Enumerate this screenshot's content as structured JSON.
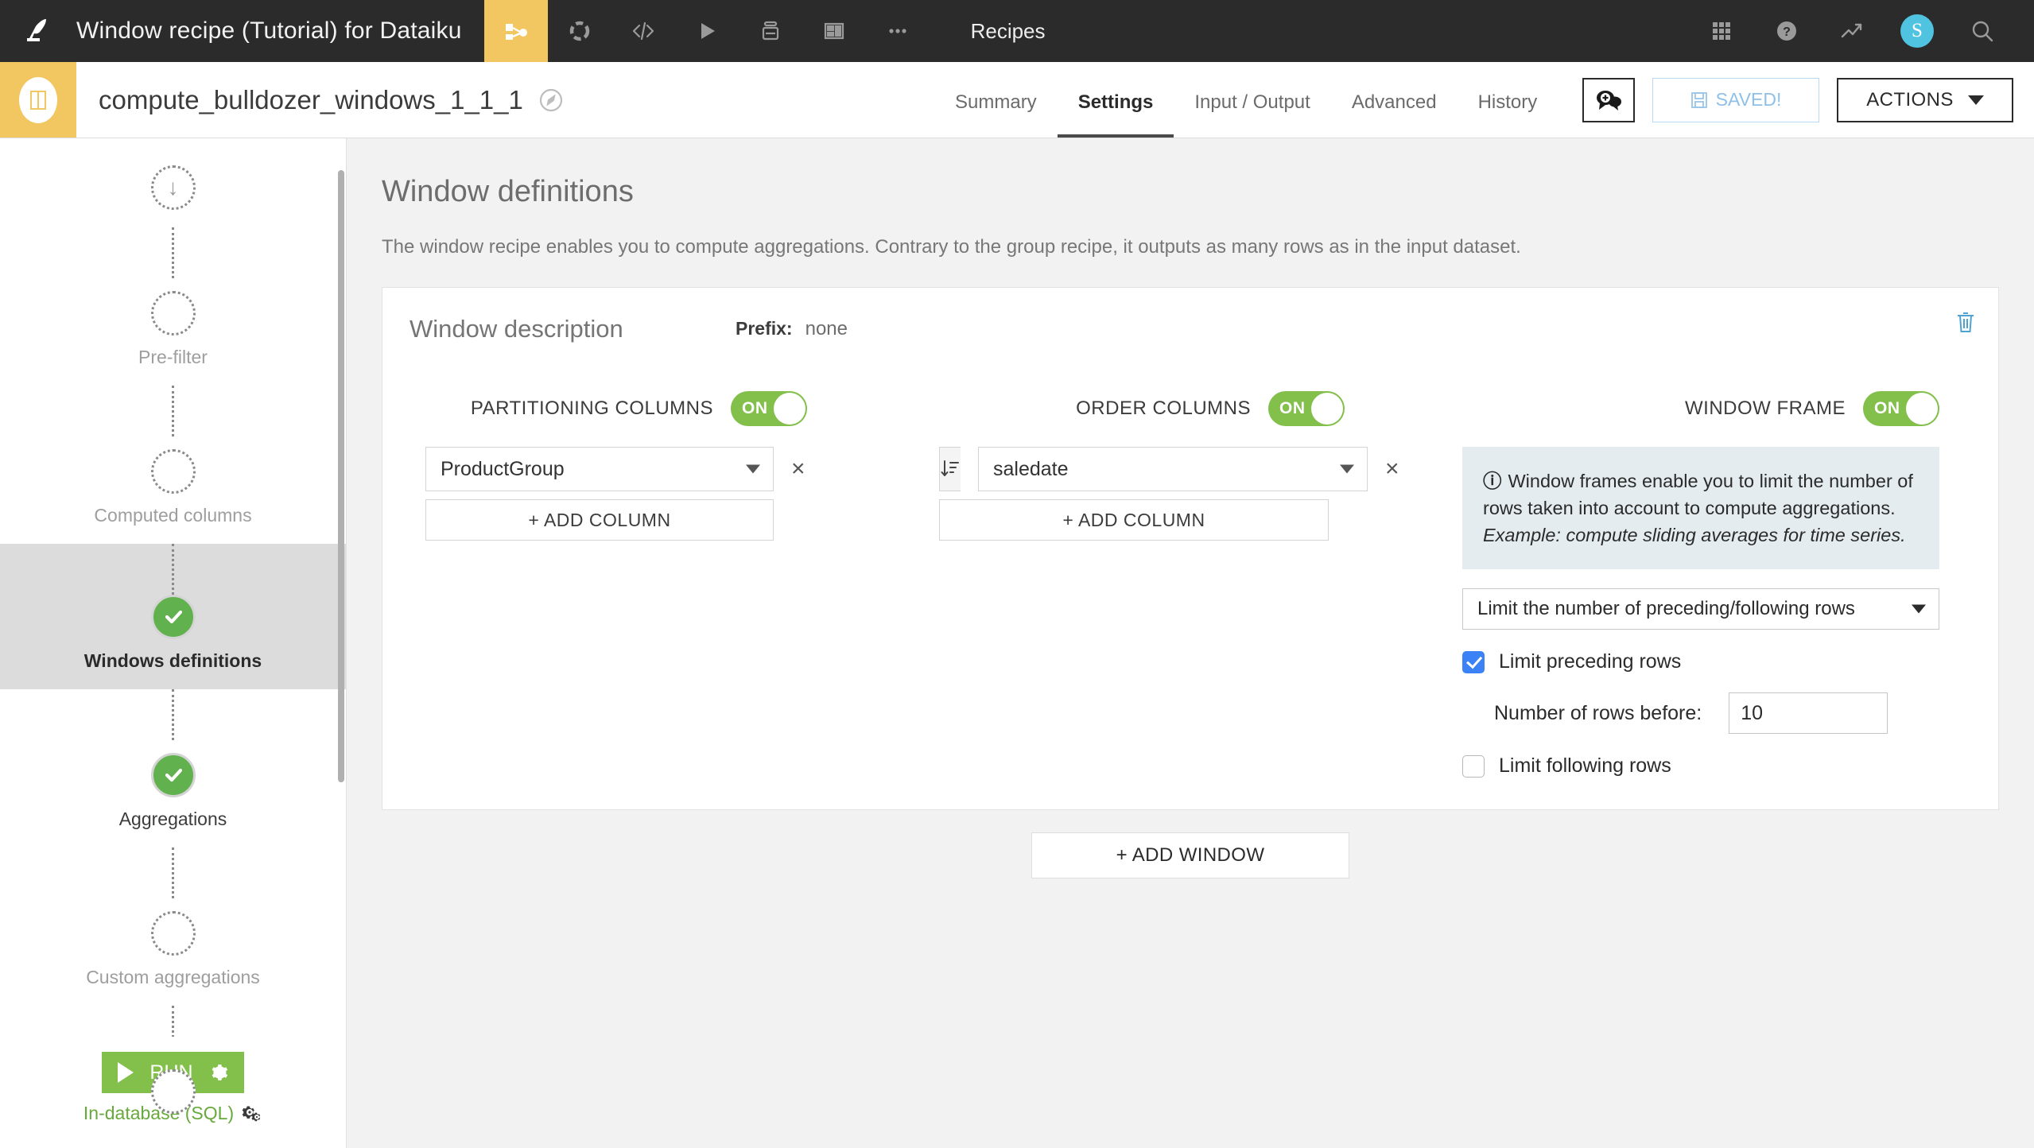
{
  "topbar": {
    "project_title": "Window recipe (Tutorial) for Dataiku",
    "section_label": "Recipes",
    "icons": [
      {
        "name": "flow-icon",
        "active": true
      },
      {
        "name": "dataset-icon",
        "active": false
      },
      {
        "name": "code-icon",
        "active": false
      },
      {
        "name": "jobs-play-icon",
        "active": false
      },
      {
        "name": "notebooks-icon",
        "active": false
      },
      {
        "name": "dashboards-icon",
        "active": false
      },
      {
        "name": "more-icon",
        "active": false
      }
    ],
    "right_icons": [
      {
        "name": "apps-grid-icon"
      },
      {
        "name": "help-icon"
      },
      {
        "name": "activity-icon"
      },
      {
        "name": "search-icon"
      }
    ],
    "avatar_initial": "S"
  },
  "subheader": {
    "recipe_name": "compute_bulldozer_windows_1_1_1",
    "tabs": [
      {
        "label": "Summary",
        "active": false
      },
      {
        "label": "Settings",
        "active": true
      },
      {
        "label": "Input / Output",
        "active": false
      },
      {
        "label": "Advanced",
        "active": false
      },
      {
        "label": "History",
        "active": false
      }
    ],
    "saved_label": "SAVED!",
    "actions_label": "ACTIONS"
  },
  "sidebar": {
    "steps": [
      {
        "label": "",
        "state": "start"
      },
      {
        "label": "Pre-filter",
        "state": "empty"
      },
      {
        "label": "Computed columns",
        "state": "empty"
      },
      {
        "label": "Windows definitions",
        "state": "done",
        "selected": true
      },
      {
        "label": "Aggregations",
        "state": "done"
      },
      {
        "label": "Custom aggregations",
        "state": "empty"
      },
      {
        "label": "",
        "state": "empty"
      }
    ],
    "run_label": "RUN",
    "engine_label": "In-database (SQL)"
  },
  "main": {
    "page_title": "Window definitions",
    "page_desc": "The window recipe enables you to compute aggregations. Contrary to the group recipe, it outputs as many rows as in the input dataset.",
    "window": {
      "description_placeholder": "Window description",
      "description_value": "",
      "prefix_label": "Prefix:",
      "prefix_value": "none",
      "partitioning": {
        "title": "PARTITIONING COLUMNS",
        "toggle_state": "ON",
        "columns": [
          "ProductGroup"
        ],
        "add_label": "+ ADD COLUMN"
      },
      "order": {
        "title": "ORDER COLUMNS",
        "toggle_state": "ON",
        "columns": [
          "saledate"
        ],
        "add_label": "+ ADD COLUMN"
      },
      "frame": {
        "title": "WINDOW FRAME",
        "toggle_state": "ON",
        "info_text": "Window frames enable you to limit the number of rows taken into account to compute aggregations.",
        "info_example": "Example: compute sliding averages for time series.",
        "mode_value": "Limit the number of preceding/following rows",
        "limit_preceding_label": "Limit preceding rows",
        "limit_preceding_checked": true,
        "rows_before_label": "Number of rows before:",
        "rows_before_value": "10",
        "limit_following_label": "Limit following rows",
        "limit_following_checked": false
      }
    },
    "add_window_label": "+ ADD WINDOW"
  }
}
